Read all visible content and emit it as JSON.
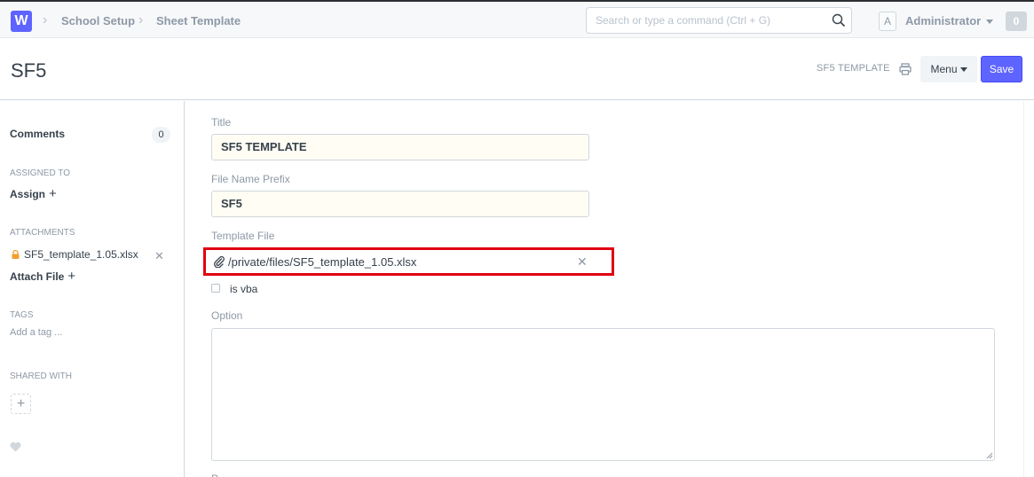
{
  "navbar": {
    "logo_letter": "W",
    "breadcrumbs": [
      "School Setup",
      "Sheet Template"
    ],
    "search_placeholder": "Search or type a command (Ctrl + G)",
    "avatar_letter": "A",
    "user_name": "Administrator",
    "notification_count": "0"
  },
  "page": {
    "title": "SF5",
    "indicator": "SF5 TEMPLATE",
    "menu_label": "Menu",
    "save_label": "Save"
  },
  "sidebar": {
    "comments_label": "Comments",
    "comments_count": "0",
    "assigned_to_label": "ASSIGNED TO",
    "assign_label": "Assign",
    "attachments_label": "ATTACHMENTS",
    "attachment_name": "SF5_template_1.05.xlsx",
    "attach_file_label": "Attach File",
    "tags_label": "TAGS",
    "add_tag_label": "Add a tag ...",
    "shared_with_label": "SHARED WITH"
  },
  "form": {
    "title_label": "Title",
    "title_value": "SF5 TEMPLATE",
    "prefix_label": "File Name Prefix",
    "prefix_value": "SF5",
    "template_file_label": "Template File",
    "template_file_value": "/private/files/SF5_template_1.05.xlsx",
    "is_vba_label": "is vba",
    "option_label": "Option"
  },
  "colors": {
    "accent": "#5e64ff",
    "highlight_border": "#e00010"
  }
}
